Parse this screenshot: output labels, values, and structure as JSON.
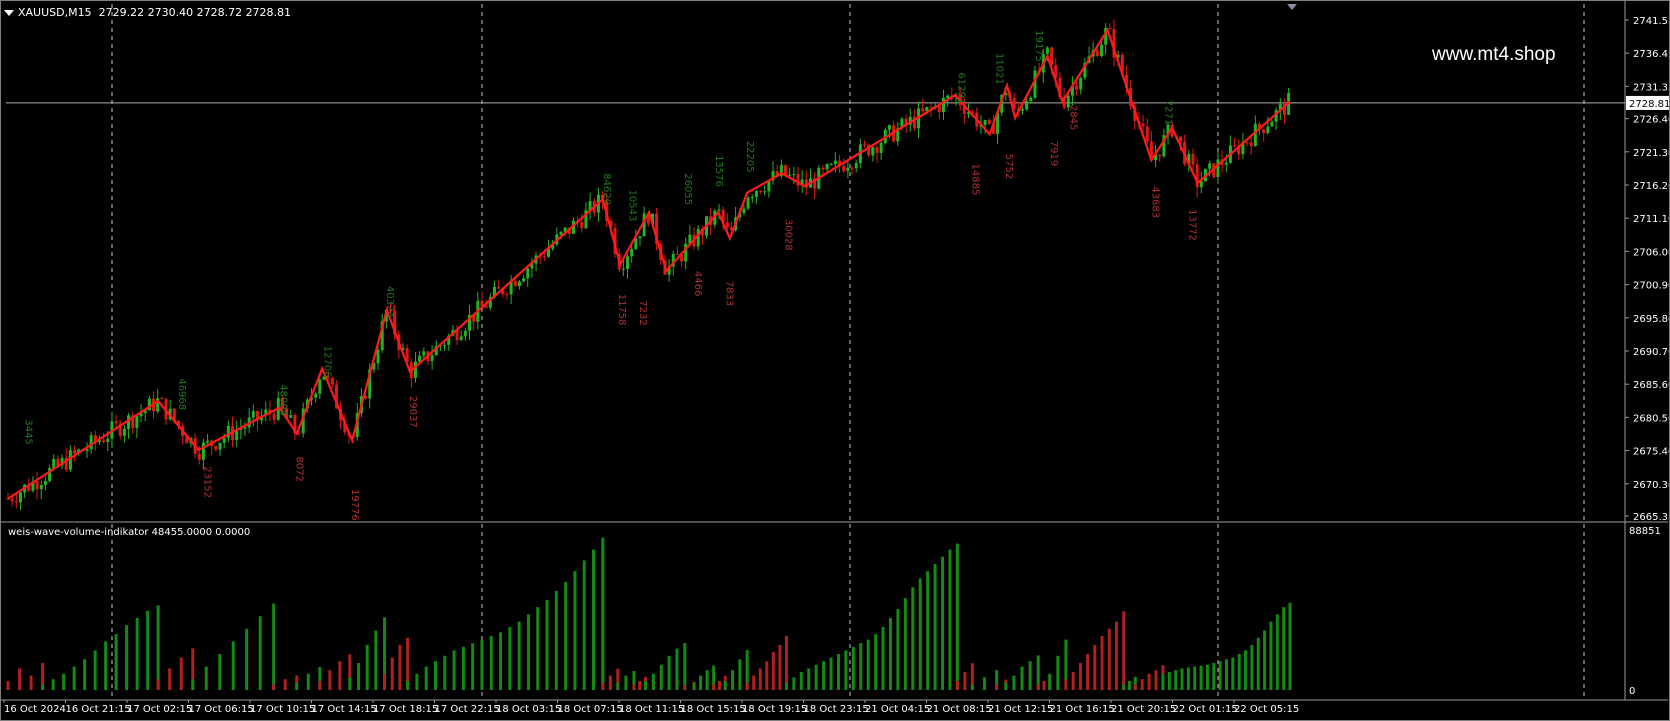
{
  "header": {
    "symbol": "XAUUSD,M15",
    "ohlc": "2729.22 2730.40 2728.72 2728.81"
  },
  "watermark": "www.mt4.shop",
  "indicator": {
    "label": "weis-wave-volume-indikator 48455.0000 0.0000",
    "max_label": "88851",
    "min_label": "0"
  },
  "colors": {
    "background": "#000000",
    "bull": "#22b522",
    "bear": "#e01818",
    "zigzag": "#ff1a1a",
    "up_wave": "#138a13",
    "down_wave": "#b02020",
    "grid": "#c0c0c0"
  },
  "chart_data": {
    "type": "candlestick",
    "price_axis": {
      "ylim": [
        2665.35,
        2741.55
      ],
      "ticks": [
        "2741.55",
        "2736.45",
        "2731.35",
        "2726.40",
        "2721.30",
        "2716.20",
        "2711.10",
        "2706.00",
        "2700.90",
        "2695.80",
        "2690.70",
        "2685.60",
        "2680.50",
        "2675.40",
        "2670.30",
        "2665.35"
      ],
      "current_price": "2728.81"
    },
    "time_axis": {
      "labels": [
        "16 Oct 2024",
        "16 Oct 21:15",
        "17 Oct 02:15",
        "17 Oct 06:15",
        "17 Oct 10:15",
        "17 Oct 14:15",
        "17 Oct 18:15",
        "17 Oct 22:15",
        "18 Oct 03:15",
        "18 Oct 07:15",
        "18 Oct 11:15",
        "18 Oct 15:15",
        "18 Oct 19:15",
        "18 Oct 23:15",
        "21 Oct 04:15",
        "21 Oct 08:15",
        "21 Oct 12:15",
        "21 Oct 16:15",
        "21 Oct 20:15",
        "22 Oct 01:15",
        "22 Oct 05:15"
      ]
    },
    "zigzag": [
      {
        "t": 0.0,
        "price": 2668.0
      },
      {
        "t": 13.0,
        "price": 2683.0
      },
      {
        "t": 16.5,
        "price": 2675.5
      },
      {
        "t": 23.5,
        "price": 2682.0
      },
      {
        "t": 25.0,
        "price": 2678.0
      },
      {
        "t": 27.2,
        "price": 2688.0
      },
      {
        "t": 29.8,
        "price": 2677.0
      },
      {
        "t": 32.8,
        "price": 2697.0
      },
      {
        "t": 34.8,
        "price": 2687.5
      },
      {
        "t": 51.5,
        "price": 2714.0
      },
      {
        "t": 53.0,
        "price": 2704.0
      },
      {
        "t": 55.5,
        "price": 2712.0
      },
      {
        "t": 57.0,
        "price": 2703.0
      },
      {
        "t": 61.5,
        "price": 2712.0
      },
      {
        "t": 62.5,
        "price": 2708.0
      },
      {
        "t": 64.0,
        "price": 2715.0
      },
      {
        "t": 67.0,
        "price": 2718.0
      },
      {
        "t": 69.0,
        "price": 2716.0
      },
      {
        "t": 82.0,
        "price": 2730.0
      },
      {
        "t": 85.0,
        "price": 2724.0
      },
      {
        "t": 86.5,
        "price": 2731.5
      },
      {
        "t": 87.2,
        "price": 2726.5
      },
      {
        "t": 90.0,
        "price": 2736.0
      },
      {
        "t": 91.3,
        "price": 2729.0
      },
      {
        "t": 95.2,
        "price": 2740.0
      },
      {
        "t": 99.0,
        "price": 2720.0
      },
      {
        "t": 100.8,
        "price": 2725.0
      },
      {
        "t": 103.0,
        "price": 2716.5
      },
      {
        "t": 111.0,
        "price": 2729.0
      }
    ],
    "wave_labels": [
      {
        "text": "3445",
        "t": 1.5,
        "price": 2680.2,
        "kind": "up"
      },
      {
        "text": "46968",
        "t": 14.8,
        "price": 2686.5,
        "kind": "up"
      },
      {
        "text": "23152",
        "t": 17.0,
        "price": 2673.0,
        "kind": "down"
      },
      {
        "text": "48004",
        "t": 23.6,
        "price": 2685.6,
        "kind": "up"
      },
      {
        "text": "8072",
        "t": 25.0,
        "price": 2674.5,
        "kind": "down"
      },
      {
        "text": "12706",
        "t": 27.4,
        "price": 2691.5,
        "kind": "up"
      },
      {
        "text": "19776",
        "t": 29.8,
        "price": 2669.5,
        "kind": "down"
      },
      {
        "text": "40324",
        "t": 32.8,
        "price": 2700.7,
        "kind": "up"
      },
      {
        "text": "29037",
        "t": 34.8,
        "price": 2683.8,
        "kind": "down"
      },
      {
        "text": "84620",
        "t": 51.6,
        "price": 2718.0,
        "kind": "up"
      },
      {
        "text": "11758",
        "t": 52.9,
        "price": 2699.5,
        "kind": "down"
      },
      {
        "text": "10543",
        "t": 53.8,
        "price": 2715.5,
        "kind": "up"
      },
      {
        "text": "7232",
        "t": 54.7,
        "price": 2698.5,
        "kind": "down"
      },
      {
        "text": "26055",
        "t": 58.6,
        "price": 2718.0,
        "kind": "up"
      },
      {
        "text": "4466",
        "t": 59.5,
        "price": 2703.0,
        "kind": "down"
      },
      {
        "text": "13576",
        "t": 61.3,
        "price": 2720.8,
        "kind": "up"
      },
      {
        "text": "7833",
        "t": 62.2,
        "price": 2701.5,
        "kind": "down"
      },
      {
        "text": "22205",
        "t": 64.0,
        "price": 2723.0,
        "kind": "up"
      },
      {
        "text": "30028",
        "t": 67.3,
        "price": 2711.0,
        "kind": "down"
      },
      {
        "text": "61291",
        "t": 82.3,
        "price": 2733.5,
        "kind": "up"
      },
      {
        "text": "14885",
        "t": 83.5,
        "price": 2719.5,
        "kind": "down"
      },
      {
        "text": "11021",
        "t": 85.6,
        "price": 2736.5,
        "kind": "up"
      },
      {
        "text": "5752",
        "t": 86.4,
        "price": 2721.0,
        "kind": "down"
      },
      {
        "text": "19175",
        "t": 89.0,
        "price": 2740.0,
        "kind": "up"
      },
      {
        "text": "7919",
        "t": 90.3,
        "price": 2723.0,
        "kind": "down"
      },
      {
        "text": "2845",
        "t": 92.0,
        "price": 2728.5,
        "kind": "down"
      },
      {
        "text": "43683",
        "t": 99.1,
        "price": 2716.0,
        "kind": "down"
      },
      {
        "text": "7271",
        "t": 100.2,
        "price": 2729.3,
        "kind": "up"
      },
      {
        "text": "13772",
        "t": 102.3,
        "price": 2712.5,
        "kind": "down"
      }
    ],
    "volume_waves": [
      {
        "dir": "down",
        "start": 0,
        "end": 3,
        "values": [
          5000,
          12000,
          8000,
          15000
        ]
      },
      {
        "dir": "up",
        "start": 3,
        "end": 13,
        "values": [
          3000,
          6000,
          9000,
          13000,
          17000,
          22000,
          27000,
          31000,
          36000,
          40000,
          44000,
          47000
        ]
      },
      {
        "dir": "down",
        "start": 13,
        "end": 16,
        "values": [
          6000,
          12000,
          18000,
          23152
        ]
      },
      {
        "dir": "up",
        "start": 16,
        "end": 23,
        "values": [
          6000,
          13000,
          20000,
          27000,
          34000,
          41000,
          48004
        ]
      },
      {
        "dir": "down",
        "start": 23,
        "end": 25,
        "values": [
          3000,
          6000,
          8072
        ]
      },
      {
        "dir": "up",
        "start": 25,
        "end": 27,
        "values": [
          4000,
          9000,
          12706
        ]
      },
      {
        "dir": "down",
        "start": 27,
        "end": 29.6,
        "values": [
          5000,
          11000,
          16000,
          19776
        ]
      },
      {
        "dir": "up",
        "start": 29.6,
        "end": 32.6,
        "values": [
          7000,
          15000,
          25000,
          33000,
          40324
        ]
      },
      {
        "dir": "down",
        "start": 32.6,
        "end": 34.6,
        "values": [
          9000,
          18000,
          25000,
          29037
        ]
      },
      {
        "dir": "up",
        "start": 34.6,
        "end": 51.5,
        "values": [
          5000,
          9000,
          13000,
          16000,
          19000,
          22000,
          24000,
          26000,
          28000,
          30000,
          32000,
          35000,
          38000,
          42000,
          46000,
          50000,
          55000,
          60000,
          66000,
          72000,
          78000,
          84620
        ]
      },
      {
        "dir": "down",
        "start": 51.5,
        "end": 52.8,
        "values": [
          4000,
          8000,
          11758
        ]
      },
      {
        "dir": "up",
        "start": 52.8,
        "end": 54.2,
        "values": [
          4000,
          8000,
          10543
        ]
      },
      {
        "dir": "down",
        "start": 54.2,
        "end": 55.2,
        "values": [
          3000,
          5000,
          7232
        ]
      },
      {
        "dir": "up",
        "start": 55.2,
        "end": 58.6,
        "values": [
          5000,
          9000,
          14000,
          19000,
          23000,
          26055
        ]
      },
      {
        "dir": "down",
        "start": 58.6,
        "end": 59.4,
        "values": [
          2500,
          4466
        ]
      },
      {
        "dir": "up",
        "start": 59.4,
        "end": 61.1,
        "values": [
          4000,
          8000,
          11000,
          13576
        ]
      },
      {
        "dir": "down",
        "start": 61.1,
        "end": 62.1,
        "values": [
          3000,
          5000,
          7833
        ]
      },
      {
        "dir": "up",
        "start": 62.1,
        "end": 64.0,
        "values": [
          5000,
          11000,
          17000,
          22205
        ]
      },
      {
        "dir": "down",
        "start": 64.0,
        "end": 67.4,
        "values": [
          4000,
          8000,
          12000,
          16000,
          21000,
          25000,
          30028
        ]
      },
      {
        "dir": "up",
        "start": 67.4,
        "end": 82.2,
        "values": [
          4000,
          7000,
          10000,
          12000,
          14000,
          16000,
          18000,
          20000,
          22000,
          24000,
          26000,
          28000,
          31000,
          35000,
          40000,
          45000,
          51000,
          57000,
          62000,
          66000,
          70000,
          74000,
          78000,
          81291
        ]
      },
      {
        "dir": "down",
        "start": 82.2,
        "end": 83.5,
        "values": [
          5000,
          10000,
          14885
        ]
      },
      {
        "dir": "up",
        "start": 83.5,
        "end": 85.6,
        "values": [
          3000,
          7000,
          11021
        ]
      },
      {
        "dir": "down",
        "start": 85.6,
        "end": 86.4,
        "values": [
          3000,
          5752
        ]
      },
      {
        "dir": "up",
        "start": 86.4,
        "end": 89.2,
        "values": [
          4000,
          8000,
          13000,
          16000,
          19175
        ]
      },
      {
        "dir": "down",
        "start": 89.2,
        "end": 90.2,
        "values": [
          3000,
          5000,
          7919
        ]
      },
      {
        "dir": "up",
        "start": 90.2,
        "end": 91.6,
        "values": [
          9000,
          19000,
          28000
        ]
      },
      {
        "dir": "down",
        "start": 91.6,
        "end": 96.6,
        "values": [
          6000,
          10000,
          15000,
          20000,
          25000,
          30000,
          34000,
          38000,
          43683
        ]
      },
      {
        "dir": "up",
        "start": 96.6,
        "end": 97.6,
        "values": [
          3000,
          5000,
          7271
        ]
      },
      {
        "dir": "down",
        "start": 97.6,
        "end": 100.0,
        "values": [
          3000,
          6000,
          9000,
          11000,
          13772
        ]
      },
      {
        "dir": "up",
        "start": 100.0,
        "end": 111.0,
        "values": [
          9000,
          10000,
          11000,
          12000,
          12500,
          13000,
          13500,
          14000,
          15000,
          16000,
          17000,
          18000,
          20000,
          22000,
          25000,
          29000,
          33000,
          38000,
          42000,
          46000,
          48455
        ]
      }
    ]
  }
}
